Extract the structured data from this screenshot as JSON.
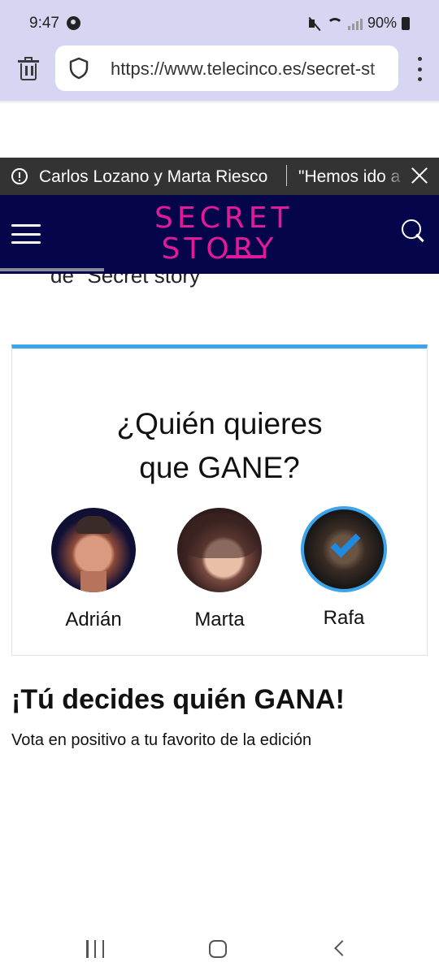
{
  "status_bar": {
    "time": "9:47",
    "battery": "90%"
  },
  "browser": {
    "url": "https://www.telecinco.es/secret-st"
  },
  "news_ticker": {
    "item_1": "Carlos Lozano y Marta Riesco",
    "item_2": "\"Hemos ido a"
  },
  "site_header": {
    "logo_line_1": "SECRET",
    "logo_line_2": "STORY"
  },
  "article": {
    "cut_text": "de \"Secret story\""
  },
  "vote_card": {
    "title_line_1": "¿Quién quieres",
    "title_line_2": "que GANE?",
    "candidates": [
      {
        "name": "Adrián",
        "selected": false
      },
      {
        "name": "Marta",
        "selected": false
      },
      {
        "name": "Rafa",
        "selected": true
      }
    ],
    "accent_color": "#3ba4ea"
  },
  "decide_section": {
    "title": "¡Tú decides quién GANA!",
    "subtitle": "Vota en positivo a tu favorito de la edición"
  },
  "colors": {
    "header_bg": "#04054a",
    "logo": "#e3199b",
    "toolbar_bg": "#d6d6f3"
  }
}
